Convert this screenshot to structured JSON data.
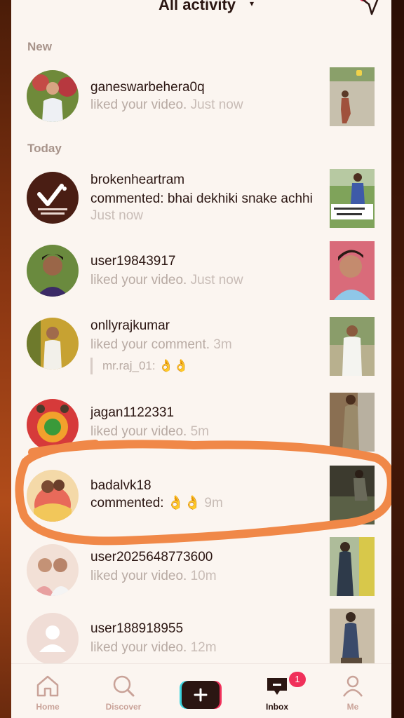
{
  "header": {
    "title": "All activity",
    "caret": "▾"
  },
  "sections": {
    "new_label": "New",
    "today_label": "Today"
  },
  "notifications": [
    {
      "user": "ganeswarbehera0q",
      "action": "liked your video.",
      "time": "Just now"
    },
    {
      "user": "brokenheartram",
      "action": "commented: bhai dekhiki snake achhi",
      "time": "Just now"
    },
    {
      "user": "user19843917",
      "action": "liked your video.",
      "time": "Just now"
    },
    {
      "user": "onllyrajkumar",
      "action": "liked your comment.",
      "time": "3m",
      "reply": "mr.raj_01: 👌👌"
    },
    {
      "user": "jagan1122331",
      "action": "liked your video.",
      "time": "5m"
    },
    {
      "user": "badalvk18",
      "action": "commented: 👌👌",
      "time": "9m"
    },
    {
      "user": "user2025648773600",
      "action": "liked your video.",
      "time": "10m"
    },
    {
      "user": "user188918955",
      "action": "liked your video.",
      "time": "12m"
    }
  ],
  "bottom_nav": {
    "home": "Home",
    "discover": "Discover",
    "inbox": "Inbox",
    "me": "Me",
    "inbox_badge": "1"
  },
  "colors": {
    "highlight": "#f08848",
    "accent_pink": "#f0305a",
    "accent_cyan": "#3cd5e0"
  }
}
